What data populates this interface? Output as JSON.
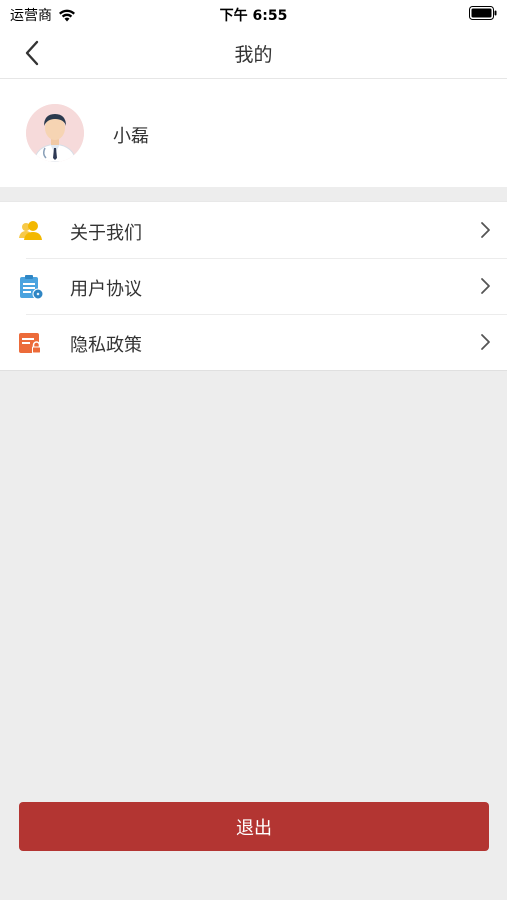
{
  "status_bar": {
    "carrier": "运营商",
    "time": "下午 6:55"
  },
  "nav": {
    "title": "我的"
  },
  "profile": {
    "name": "小磊"
  },
  "menu": {
    "items": [
      {
        "label": "关于我们",
        "icon": "users-icon"
      },
      {
        "label": "用户协议",
        "icon": "clipboard-icon"
      },
      {
        "label": "隐私政策",
        "icon": "lock-document-icon"
      }
    ]
  },
  "logout": {
    "label": "退出"
  },
  "colors": {
    "accent": "#b33532",
    "background": "#ededed",
    "icon_yellow": "#f3b800",
    "icon_blue": "#4aa3df",
    "icon_orange": "#ec6b3a"
  }
}
